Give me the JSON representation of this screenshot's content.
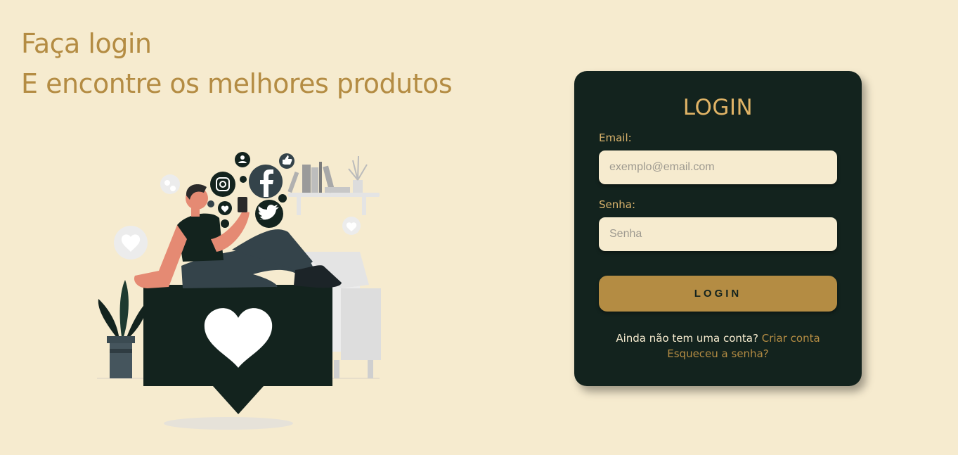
{
  "hero": {
    "line1": "Faça login",
    "line2": "E encontre os melhores produtos"
  },
  "login": {
    "title": "LOGIN",
    "email_label": "Email:",
    "email_placeholder": "exemplo@email.com",
    "password_label": "Senha:",
    "password_placeholder": "Senha",
    "button_label": "LOGIN",
    "no_account_text": "Ainda não tem uma conta?",
    "create_account_link": "Criar conta",
    "forgot_password_link": "Esqueceu a senha?"
  },
  "colors": {
    "background": "#f6ebcf",
    "card": "#13231e",
    "accent": "#b48c43"
  },
  "illustration": {
    "icons": [
      "instagram-icon",
      "facebook-icon",
      "twitter-icon",
      "heart-icon",
      "like-icon",
      "user-icon"
    ]
  }
}
